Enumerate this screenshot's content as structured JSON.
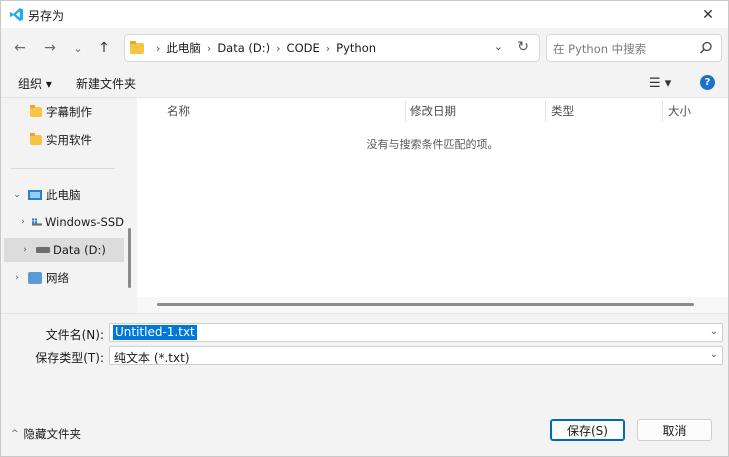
{
  "window": {
    "title": "另存为",
    "close_glyph": "✕"
  },
  "nav": {
    "back_glyph": "←",
    "forward_glyph": "→",
    "recent_glyph": "⌄",
    "up_glyph": "↑",
    "breadcrumbs": [
      "此电脑",
      "Data (D:)",
      "CODE",
      "Python"
    ],
    "separator": "›",
    "dropdown_glyph": "⌄",
    "refresh_glyph": "↻",
    "search_placeholder": "在 Python 中搜索"
  },
  "toolbar": {
    "organize_label": "组织 ▾",
    "new_folder_label": "新建文件夹",
    "view_glyph": "☰ ▾",
    "help_glyph": "?"
  },
  "sidebar": {
    "items": [
      {
        "label": "字幕制作",
        "type": "folder",
        "chevron": ""
      },
      {
        "label": "实用软件",
        "type": "folder",
        "chevron": ""
      },
      {
        "label": "此电脑",
        "type": "pc",
        "chevron": "⌄"
      },
      {
        "label": "Windows-SSD",
        "type": "win-drive",
        "chevron": "›"
      },
      {
        "label": "Data (D:)",
        "type": "drive",
        "chevron": "›"
      },
      {
        "label": "网络",
        "type": "network",
        "chevron": "›"
      }
    ]
  },
  "content": {
    "columns": [
      "名称",
      "修改日期",
      "类型",
      "大小"
    ],
    "sort_glyph": "^",
    "empty_message": "没有与搜索条件匹配的项。"
  },
  "fields": {
    "filename_label": "文件名(N):",
    "filename_value": "Untitled-1.txt",
    "filetype_label": "保存类型(T):",
    "filetype_value": "纯文本 (*.txt)",
    "chevron": "⌄"
  },
  "footer": {
    "hide_folders_label": "隐藏文件夹",
    "caret_glyph": "^",
    "save_label": "保存(S)",
    "cancel_label": "取消"
  },
  "colors": {
    "accent": "#0078d7",
    "vscode_blue": "#23a9f2",
    "help_blue": "#1a73c9",
    "folder_yellow": "#f8c444"
  }
}
